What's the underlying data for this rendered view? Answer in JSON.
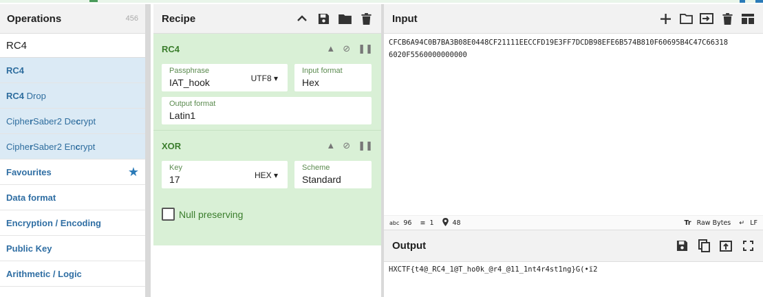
{
  "operations": {
    "title": "Operations",
    "count": "456",
    "search_value": "RC4",
    "results": [
      {
        "label": "RC4",
        "parts": [
          {
            "t": "RC4",
            "b": true
          }
        ]
      },
      {
        "label": "RC4 Drop",
        "parts": [
          {
            "t": "RC4",
            "b": true
          },
          {
            "t": " Drop",
            "b": false
          }
        ]
      },
      {
        "label": "CipherSaber2 Decrypt",
        "parts": [
          {
            "t": "Ciphe",
            "b": false
          },
          {
            "t": "r",
            "b": true
          },
          {
            "t": "Saber2 De",
            "b": false
          },
          {
            "t": "c",
            "b": true
          },
          {
            "t": "rypt",
            "b": false
          }
        ]
      },
      {
        "label": "CipherSaber2 Encrypt",
        "parts": [
          {
            "t": "Ciphe",
            "b": false
          },
          {
            "t": "r",
            "b": true
          },
          {
            "t": "Saber2 En",
            "b": false
          },
          {
            "t": "c",
            "b": true
          },
          {
            "t": "rypt",
            "b": false
          }
        ]
      }
    ],
    "categories": [
      "Favourites",
      "Data format",
      "Encryption / Encoding",
      "Public Key",
      "Arithmetic / Logic"
    ]
  },
  "recipe": {
    "title": "Recipe",
    "ops": [
      {
        "name": "RC4",
        "fields": [
          [
            {
              "label": "Passphrase",
              "value": "IAT_hook",
              "dropdown": "UTF8",
              "width": 183
            },
            {
              "label": "Input format",
              "value": "Hex",
              "width": 112
            }
          ],
          [
            {
              "label": "Output format",
              "value": "Latin1",
              "width": 305
            }
          ]
        ]
      },
      {
        "name": "XOR",
        "fields": [
          [
            {
              "label": "Key",
              "value": "17",
              "dropdown": "HEX",
              "width": 183
            },
            {
              "label": "Scheme",
              "value": "Standard",
              "width": 112
            }
          ]
        ]
      }
    ],
    "null_preserving_label": "Null preserving"
  },
  "input": {
    "title": "Input",
    "text": "CFCB6A94C0B7BA3B08E0448CF21111EECCFD19E3FF7DCDB98EFE6B574B810F60695B4C47C66318\n6020F5560000000000",
    "status": {
      "length": "96",
      "lines": "1",
      "pos": "48",
      "raw_bytes": "Raw Bytes",
      "eol": "LF"
    }
  },
  "output": {
    "title": "Output",
    "text": "HXCTF{t4@_RC4_1@T_ho0k_@r4_@11_1nt4r4st1ng}G(•ï2"
  }
}
